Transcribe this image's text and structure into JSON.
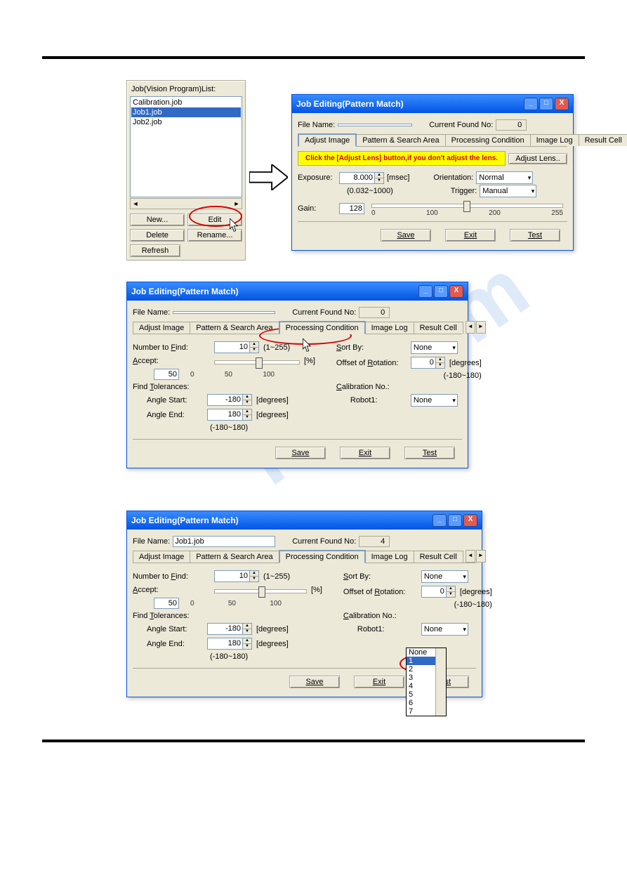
{
  "joblist": {
    "title": "Job(Vision Program)List:",
    "items": [
      "Calibration.job",
      "Job1.job",
      "Job2.job"
    ],
    "selected": 1,
    "btn_new": "New...",
    "btn_edit": "Edit",
    "btn_delete": "Delete",
    "btn_rename": "Rename...",
    "btn_refresh": "Refresh"
  },
  "dlg1": {
    "title": "Job Editing(Pattern Match)",
    "file_name_label": "File Name:",
    "file_name_value": "",
    "found_label": "Current Found No:",
    "found_value": "0",
    "tabs": [
      "Adjust Image",
      "Pattern & Search Area",
      "Processing Condition",
      "Image Log",
      "Result Cell"
    ],
    "active_tab": 0,
    "banner": "Click the [Adjust Lens] button,if you don't adjust the lens.",
    "adjust_lens_btn": "Adjust Lens..",
    "exposure_label": "Exposure:",
    "exposure_value": "8.000",
    "exposure_unit": "[msec]",
    "exposure_range": "(0.032~1000)",
    "gain_label": "Gain:",
    "gain_value": "128",
    "gain_ticks": [
      "0",
      "100",
      "200",
      "255"
    ],
    "orientation_label": "Orientation:",
    "orientation_value": "Normal",
    "trigger_label": "Trigger:",
    "trigger_value": "Manual",
    "btn_save": "Save",
    "btn_exit": "Exit",
    "btn_test": "Test"
  },
  "dlg2": {
    "title": "Job Editing(Pattern Match)",
    "file_name_label": "File Name:",
    "file_name_value": "",
    "found_label": "Current Found No:",
    "found_value": "0",
    "tabs": [
      "Adjust Image",
      "Pattern & Search Area",
      "Processing Condition",
      "Image Log",
      "Result Cell"
    ],
    "active_tab": 2,
    "number_find_label": "Number to Find:",
    "number_find_value": "10",
    "number_find_range": "(1~255)",
    "accept_label": "Accept:",
    "accept_value": "50",
    "accept_unit": "[%]",
    "accept_ticks": [
      "0",
      "50",
      "100"
    ],
    "find_tol_label": "Find Tolerances:",
    "angle_start_label": "Angle Start:",
    "angle_start_value": "-180",
    "angle_end_label": "Angle End:",
    "angle_end_value": "180",
    "deg_unit": "[degrees]",
    "angle_range": "(-180~180)",
    "sortby_label": "Sort By:",
    "sortby_value": "None",
    "offset_rot_label": "Offset of Rotation:",
    "offset_rot_value": "0",
    "offset_rot_range": "(-180~180)",
    "calib_label": "Calibration No.:",
    "robot_label": "Robot1:",
    "robot_value": "None",
    "btn_save": "Save",
    "btn_exit": "Exit",
    "btn_test": "Test"
  },
  "dlg3": {
    "title": "Job Editing(Pattern Match)",
    "file_name_label": "File Name:",
    "file_name_value": "Job1.job",
    "found_label": "Current Found No:",
    "found_value": "4",
    "tabs": [
      "Adjust Image",
      "Pattern & Search Area",
      "Processing Condition",
      "Image Log",
      "Result Cell"
    ],
    "active_tab": 2,
    "number_find_label": "Number to Find:",
    "number_find_value": "10",
    "number_find_range": "(1~255)",
    "accept_label": "Accept:",
    "accept_value": "50",
    "accept_unit": "[%]",
    "accept_ticks": [
      "0",
      "50",
      "100"
    ],
    "find_tol_label": "Find Tolerances:",
    "angle_start_label": "Angle Start:",
    "angle_start_value": "-180",
    "angle_end_label": "Angle End:",
    "angle_end_value": "180",
    "deg_unit": "[degrees]",
    "angle_range": "(-180~180)",
    "sortby_label": "Sort By:",
    "sortby_value": "None",
    "offset_rot_label": "Offset of Rotation:",
    "offset_rot_value": "0",
    "offset_rot_range": "(-180~180)",
    "calib_label": "Calibration No.:",
    "robot_label": "Robot1:",
    "robot_value": "None",
    "drop_options": [
      "None",
      "1",
      "2",
      "3",
      "4",
      "5",
      "6",
      "7"
    ],
    "drop_selected": 1,
    "btn_save": "Save",
    "btn_exit": "Exit",
    "btn_test": "Test"
  }
}
